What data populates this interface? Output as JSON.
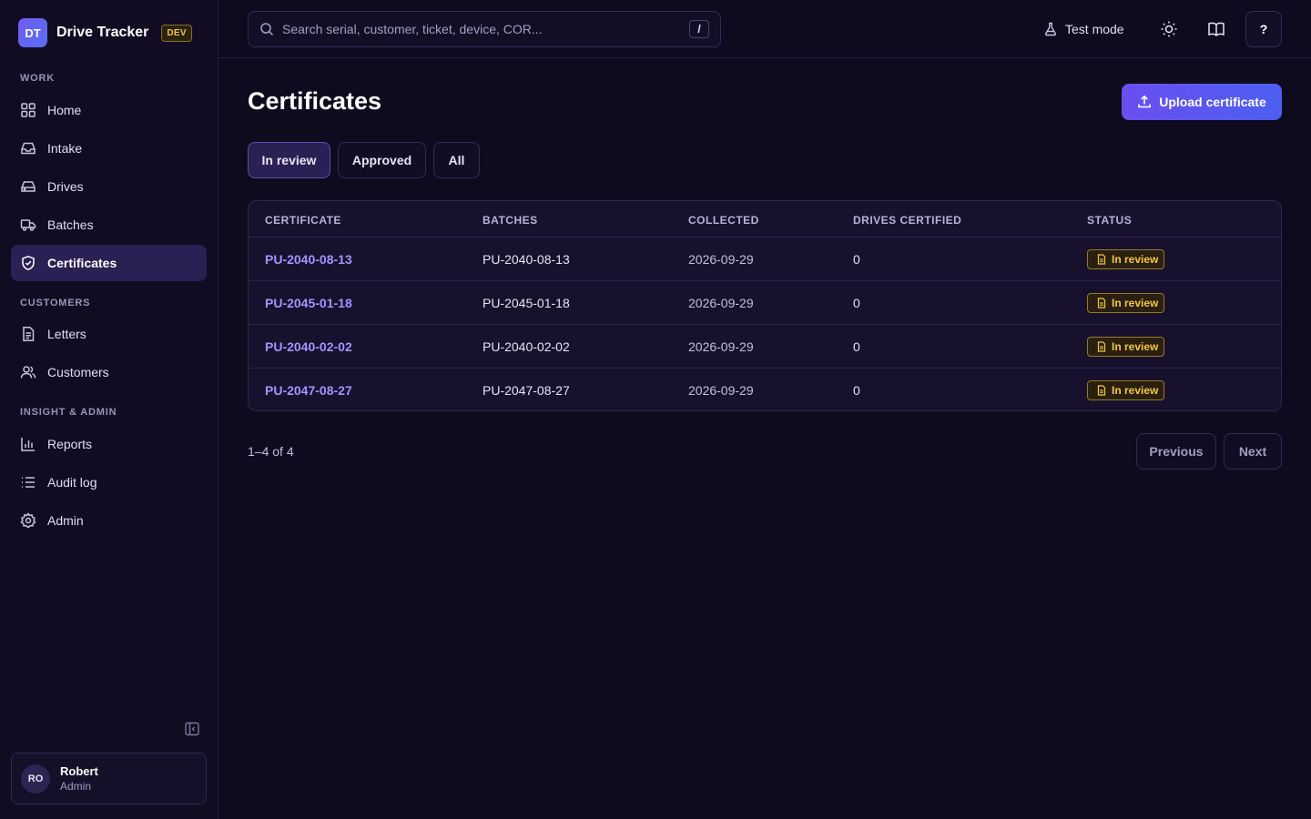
{
  "brand": {
    "initials": "DT",
    "name": "Drive Tracker",
    "env_badge": "DEV"
  },
  "sidebar": {
    "sections": [
      {
        "label": "WORK",
        "items": [
          {
            "label": "Home",
            "icon": "grid-icon"
          },
          {
            "label": "Intake",
            "icon": "inbox-icon"
          },
          {
            "label": "Drives",
            "icon": "drive-icon"
          },
          {
            "label": "Batches",
            "icon": "truck-icon"
          },
          {
            "label": "Certificates",
            "icon": "shield-check-icon",
            "active": true
          }
        ]
      },
      {
        "label": "CUSTOMERS",
        "items": [
          {
            "label": "Letters",
            "icon": "document-icon"
          },
          {
            "label": "Customers",
            "icon": "users-icon"
          }
        ]
      },
      {
        "label": "INSIGHT & ADMIN",
        "items": [
          {
            "label": "Reports",
            "icon": "bar-chart-icon"
          },
          {
            "label": "Audit log",
            "icon": "list-icon"
          },
          {
            "label": "Admin",
            "icon": "gear-icon"
          }
        ]
      }
    ],
    "user": {
      "initials": "RO",
      "name": "Robert",
      "role": "Admin"
    }
  },
  "topbar": {
    "search_placeholder": "Search serial, customer, ticket, device, COR...",
    "search_shortcut": "/",
    "test_mode_label": "Test mode",
    "help_label": "?"
  },
  "main": {
    "title": "Certificates",
    "upload_label": "Upload certificate",
    "tabs": [
      {
        "label": "In review",
        "active": true
      },
      {
        "label": "Approved",
        "active": false
      },
      {
        "label": "All",
        "active": false
      }
    ],
    "table": {
      "columns": [
        "CERTIFICATE",
        "BATCHES",
        "COLLECTED",
        "DRIVES CERTIFIED",
        "STATUS"
      ],
      "rows": [
        {
          "certificate": "PU-2040-08-13",
          "batches": "PU-2040-08-13",
          "collected": "2026-09-29",
          "drives_certified": "0",
          "status": "In review"
        },
        {
          "certificate": "PU-2045-01-18",
          "batches": "PU-2045-01-18",
          "collected": "2026-09-29",
          "drives_certified": "0",
          "status": "In review"
        },
        {
          "certificate": "PU-2040-02-02",
          "batches": "PU-2040-02-02",
          "collected": "2026-09-29",
          "drives_certified": "0",
          "status": "In review"
        },
        {
          "certificate": "PU-2047-08-27",
          "batches": "PU-2047-08-27",
          "collected": "2026-09-29",
          "drives_certified": "0",
          "status": "In review"
        }
      ]
    },
    "pagination": {
      "summary": "1–4 of 4",
      "previous_label": "Previous",
      "next_label": "Next"
    }
  },
  "colors": {
    "accent": "#6a4ff0",
    "link": "#a493ff",
    "status_review": "#f3c54a",
    "background": "#0f0b1e"
  }
}
